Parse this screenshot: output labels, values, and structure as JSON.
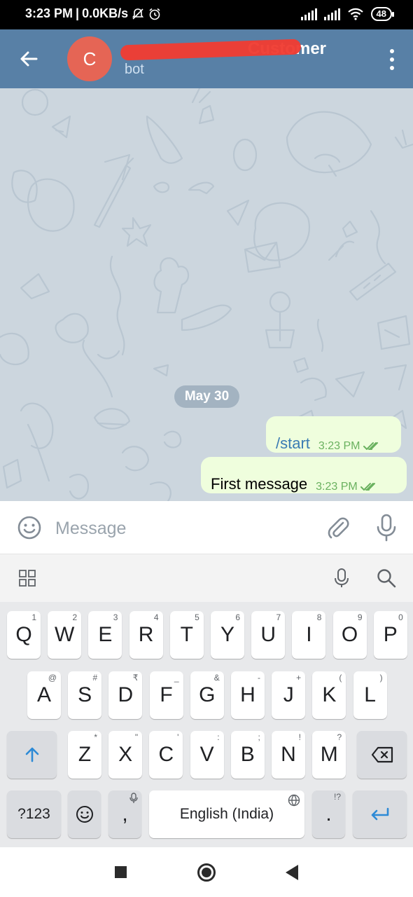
{
  "status_bar": {
    "time": "3:23 PM",
    "separator": "|",
    "net_speed": "0.0KB/s",
    "battery": "48"
  },
  "header": {
    "avatar_letter": "C",
    "title": "Customer",
    "subtitle": "bot"
  },
  "chat": {
    "date_label": "May 30",
    "messages": [
      {
        "text": "/start",
        "time": "3:23 PM",
        "status": "read"
      },
      {
        "text": "First message",
        "time": "3:23 PM",
        "status": "read"
      }
    ]
  },
  "composer": {
    "placeholder": "Message"
  },
  "keyboard": {
    "row1": [
      {
        "k": "Q",
        "h": "1"
      },
      {
        "k": "W",
        "h": "2"
      },
      {
        "k": "E",
        "h": "3"
      },
      {
        "k": "R",
        "h": "4"
      },
      {
        "k": "T",
        "h": "5"
      },
      {
        "k": "Y",
        "h": "6"
      },
      {
        "k": "U",
        "h": "7"
      },
      {
        "k": "I",
        "h": "8"
      },
      {
        "k": "O",
        "h": "9"
      },
      {
        "k": "P",
        "h": "0"
      }
    ],
    "row2": [
      {
        "k": "A",
        "h": "@"
      },
      {
        "k": "S",
        "h": "#"
      },
      {
        "k": "D",
        "h": "₹"
      },
      {
        "k": "F",
        "h": "_"
      },
      {
        "k": "G",
        "h": "&"
      },
      {
        "k": "H",
        "h": "-"
      },
      {
        "k": "J",
        "h": "+"
      },
      {
        "k": "K",
        "h": "("
      },
      {
        "k": "L",
        "h": ")"
      }
    ],
    "row3": [
      {
        "k": "Z",
        "h": "*"
      },
      {
        "k": "X",
        "h": "\""
      },
      {
        "k": "C",
        "h": "'"
      },
      {
        "k": "V",
        "h": ":"
      },
      {
        "k": "B",
        "h": ";"
      },
      {
        "k": "N",
        "h": "!"
      },
      {
        "k": "M",
        "h": "?"
      }
    ],
    "symbols_label": "?123",
    "comma_label": ",",
    "space_label": "English (India)",
    "period_label": ".",
    "period_hint": "!?"
  },
  "colors": {
    "header": "#5880a6",
    "avatar": "#e56555",
    "bubble_out": "#effedd",
    "read_ticks": "#6ab15f",
    "chat_bg": "#ccd6de",
    "accent": "#3b8fd0"
  }
}
